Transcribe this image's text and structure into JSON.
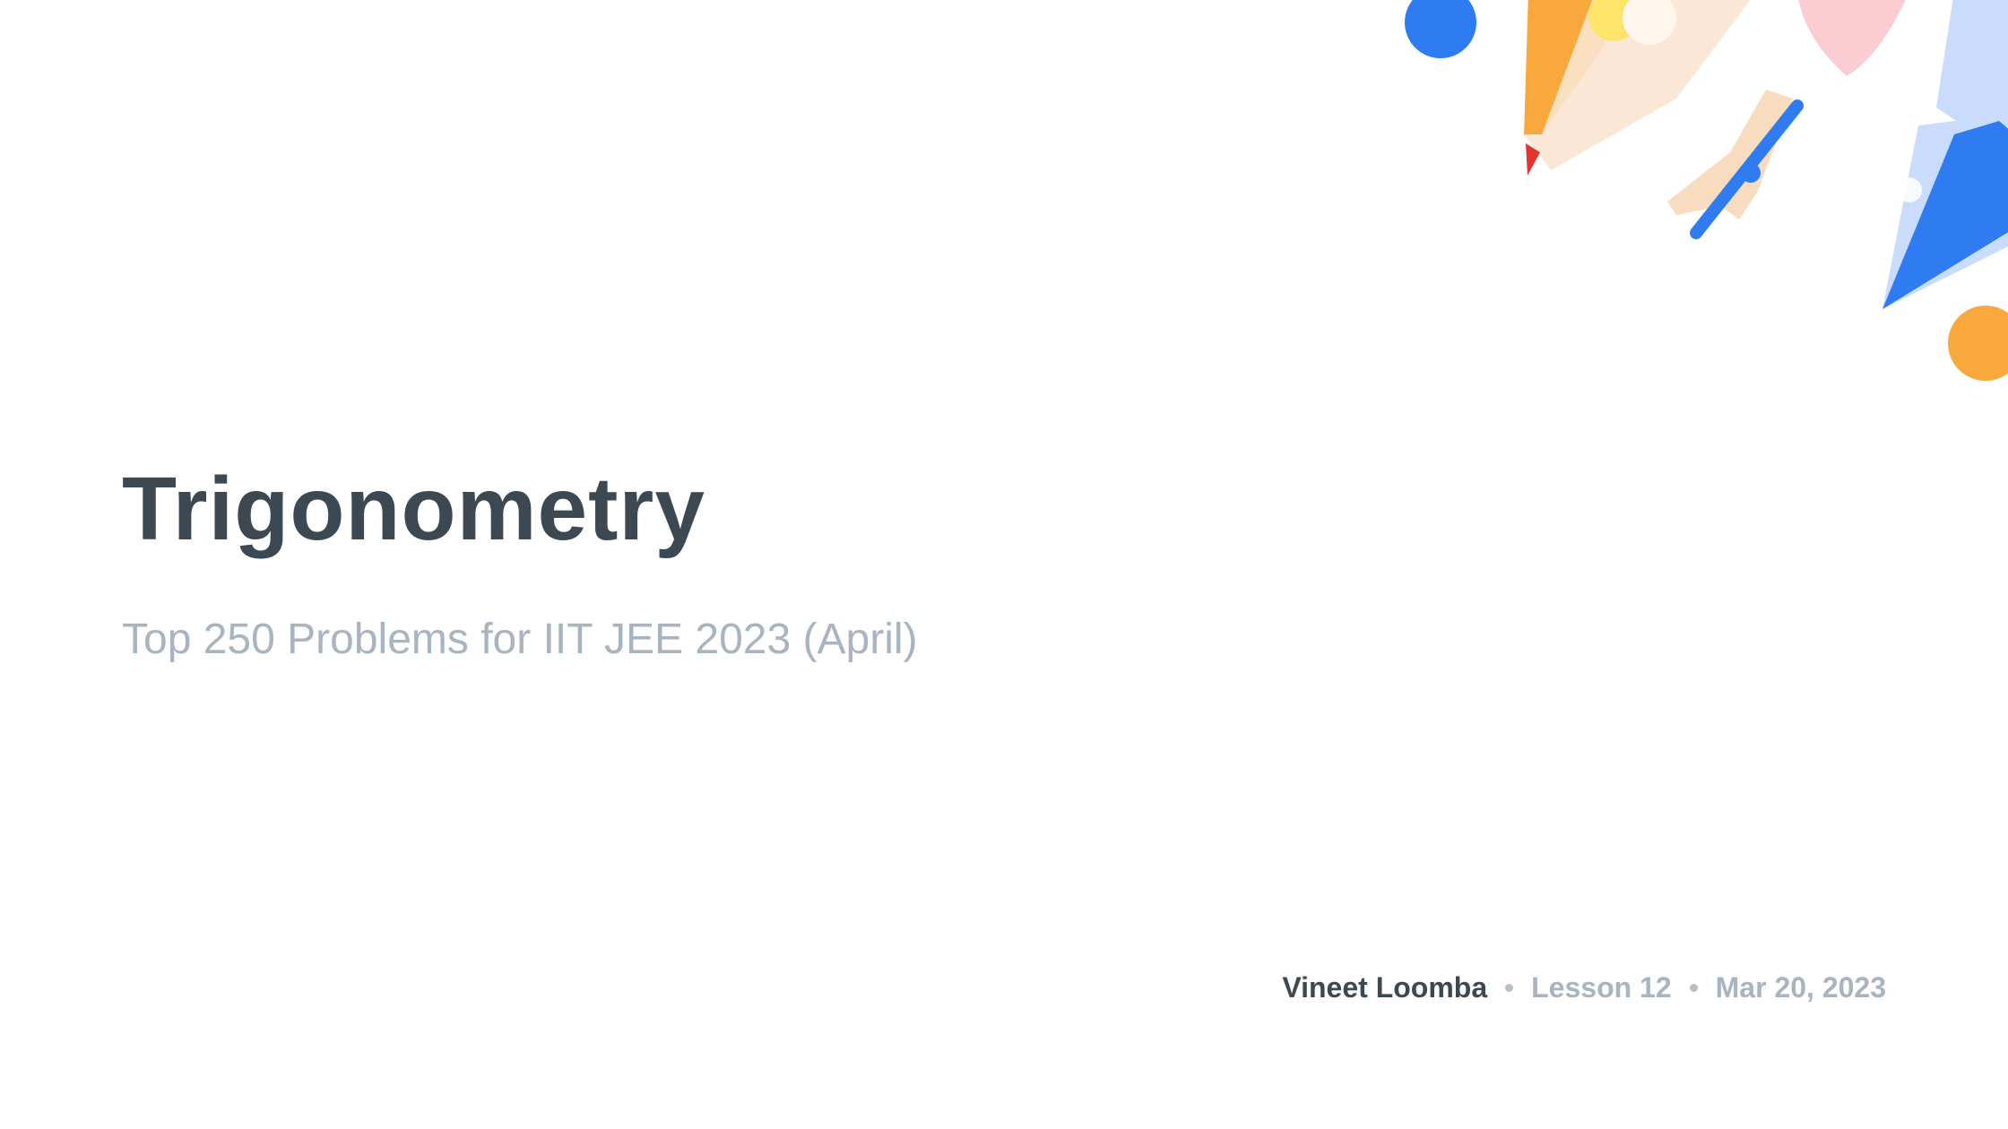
{
  "slide": {
    "title": "Trigonometry",
    "subtitle": "Top 250 Problems for IIT JEE 2023 (April)",
    "author": "Vineet Loomba",
    "lesson": "Lesson 12",
    "date": "Mar 20, 2023"
  },
  "decoration": {
    "icons": [
      "pencil-icon",
      "pen-nib-icon",
      "ruler-icon",
      "dot-blue",
      "dot-orange"
    ],
    "colors": {
      "blue": "#2f7bf2",
      "light_blue": "#c9dcfb",
      "orange": "#f9a93b",
      "peach": "#f8dcc0",
      "pink": "#f9cdd2",
      "yellow": "#fce56a",
      "red": "#e5342f"
    }
  }
}
